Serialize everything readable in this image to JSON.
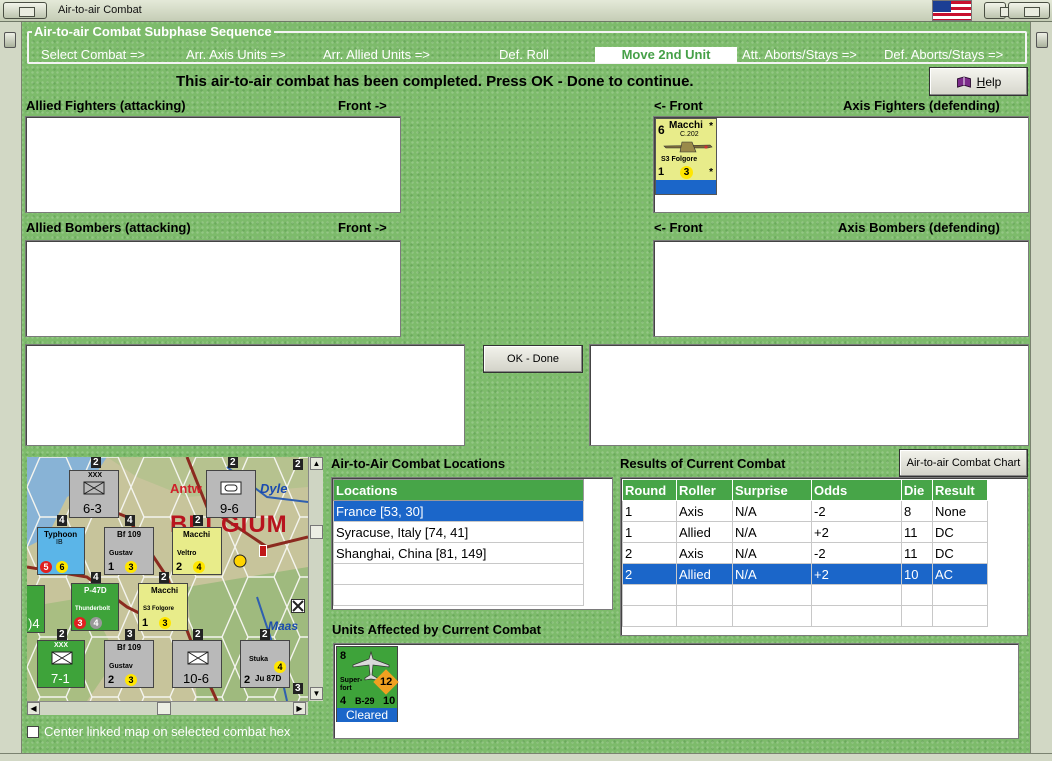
{
  "window": {
    "title": "Air-to-air Combat"
  },
  "sequence": {
    "legend": "Air-to-air Combat Subphase Sequence",
    "steps": [
      {
        "label": "Select Combat =>",
        "active": false
      },
      {
        "label": "Arr. Axis Units =>",
        "active": false
      },
      {
        "label": "Arr. Allied Units =>",
        "active": false
      },
      {
        "label": "Def. Roll",
        "active": false
      },
      {
        "label": "Move 2nd Unit",
        "active": true
      },
      {
        "label": "Att. Aborts/Stays =>",
        "active": false
      },
      {
        "label": "Def. Aborts/Stays =>",
        "active": false
      }
    ]
  },
  "status_message": "This air-to-air combat has been completed.  Press OK - Done to continue.",
  "help_button": {
    "label_underlined": "H",
    "label_rest": "elp"
  },
  "panels": {
    "allied_fighters": {
      "label": "Allied Fighters (attacking)",
      "front": "Front ->"
    },
    "axis_fighters": {
      "label": "Axis Fighters (defending)",
      "front": "<- Front"
    },
    "allied_bombers": {
      "label": "Allied Bombers (attacking)",
      "front": "Front ->"
    },
    "axis_bombers": {
      "label": "Axis Bombers (defending)",
      "front": "<- Front"
    }
  },
  "axis_fighter_unit": {
    "name": "Macchi",
    "model": "C.202",
    "subtitle": "S3 Folgore",
    "air_to_air": "6",
    "bottom_left": "1",
    "bottom_mid": "3",
    "star": "*"
  },
  "ok_button": "OK - Done",
  "chart_button": "Air-to-air Combat Chart",
  "locations": {
    "title": "Air-to-Air Combat Locations",
    "header": "Locations",
    "rows": [
      "France [53, 30]",
      "Syracuse, Italy [74, 41]",
      "Shanghai, China [81, 149]",
      "",
      ""
    ],
    "selected_index": 0
  },
  "results": {
    "title": "Results of Current Combat",
    "headers": [
      "Round",
      "Roller",
      "Surprise",
      "Odds",
      "Die",
      "Result"
    ],
    "rows": [
      [
        "1",
        "Axis",
        "N/A",
        "-2",
        "8",
        "None"
      ],
      [
        "1",
        "Allied",
        "N/A",
        "+2",
        "11",
        "DC"
      ],
      [
        "2",
        "Axis",
        "N/A",
        "-2",
        "11",
        "DC"
      ],
      [
        "2",
        "Allied",
        "N/A",
        "+2",
        "10",
        "AC"
      ],
      [
        "",
        "",
        "",
        "",
        "",
        ""
      ],
      [
        "",
        "",
        "",
        "",
        "",
        ""
      ]
    ],
    "selected_index": 3
  },
  "affected": {
    "title": "Units Affected by Current Combat",
    "unit": {
      "top_left": "8",
      "name": "Super-fort",
      "model": "B-29",
      "bottom_left": "4",
      "range": "12",
      "bottom_right": "10",
      "status": "Cleared"
    }
  },
  "map": {
    "labels": [
      "Antw",
      "Dyle",
      "BELGIUM",
      "Maas"
    ],
    "counters": [
      {
        "top": "XXX",
        "value": "6-3"
      },
      {
        "top": "",
        "value": "9-6"
      },
      {
        "top": "XXX",
        "value": "7-1"
      },
      {
        "top": "",
        "value": "10-6"
      },
      {
        "top": "",
        "value": ")4"
      }
    ],
    "air_units": [
      {
        "name": "Typhoon",
        "sub": "IB",
        "a": "5",
        "b": "6"
      },
      {
        "name": "Bf 109",
        "sub": "Gustav",
        "a": "1",
        "b": "3"
      },
      {
        "name": "Macchi",
        "sub": "Veltro",
        "a": "2",
        "b": "4"
      },
      {
        "name": "P-47D",
        "sub": "Thunderbolt",
        "a": "3",
        "b": "4"
      },
      {
        "name": "Macchi",
        "sub": "S3 Folgore",
        "a": "1",
        "b": "3"
      },
      {
        "name": "Bf 109",
        "sub": "Gustav",
        "a": "2",
        "b": "3"
      },
      {
        "name": "Stuka",
        "sub": "Ju 87D",
        "a": "2",
        "b": "4"
      }
    ],
    "unit_sizes": [
      "2",
      "2",
      "4",
      "4",
      "2",
      "4",
      "2",
      "2",
      "3",
      "2",
      "2",
      "3",
      "2"
    ],
    "checkbox_label": "Center linked map on selected combat hex",
    "checked": false
  },
  "colors": {
    "felt": "#7dbb6b",
    "header_green": "#47a548",
    "selection_blue": "#1b66c9",
    "axis_yellow": "#e8ec8a",
    "allied_green": "#3ea33a"
  }
}
